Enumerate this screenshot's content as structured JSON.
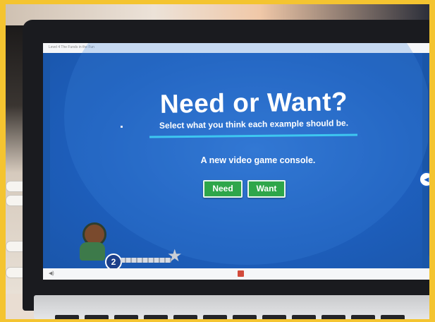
{
  "screen": {
    "breadcrumb": "Level 4 The Funds in the Fun",
    "title": "Need or Want?",
    "subtitle": "Select what you think each example should be.",
    "question": "A new video game console.",
    "buttons": {
      "need_label": "Need",
      "want_label": "Want"
    },
    "progress": {
      "step": "2"
    },
    "colors": {
      "stage_blue": "#1e5fbd",
      "button_green": "#2ea64a",
      "underline_cyan": "#3ec7f0",
      "frame_yellow": "#f4c430"
    },
    "icons": [
      "avatar-icon",
      "star-icon",
      "arrow-left-icon",
      "speaker-icon"
    ]
  }
}
